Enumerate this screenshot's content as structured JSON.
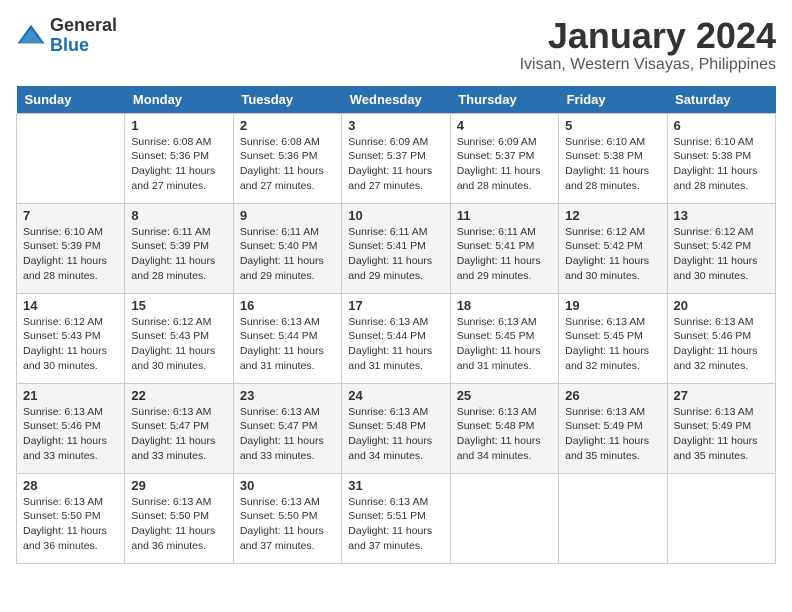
{
  "logo": {
    "general": "General",
    "blue": "Blue"
  },
  "title": {
    "month": "January 2024",
    "location": "Ivisan, Western Visayas, Philippines"
  },
  "weekdays": [
    "Sunday",
    "Monday",
    "Tuesday",
    "Wednesday",
    "Thursday",
    "Friday",
    "Saturday"
  ],
  "weeks": [
    [
      {
        "day": "",
        "sunrise": "",
        "sunset": "",
        "daylight": ""
      },
      {
        "day": "1",
        "sunrise": "Sunrise: 6:08 AM",
        "sunset": "Sunset: 5:36 PM",
        "daylight": "Daylight: 11 hours and 27 minutes."
      },
      {
        "day": "2",
        "sunrise": "Sunrise: 6:08 AM",
        "sunset": "Sunset: 5:36 PM",
        "daylight": "Daylight: 11 hours and 27 minutes."
      },
      {
        "day": "3",
        "sunrise": "Sunrise: 6:09 AM",
        "sunset": "Sunset: 5:37 PM",
        "daylight": "Daylight: 11 hours and 27 minutes."
      },
      {
        "day": "4",
        "sunrise": "Sunrise: 6:09 AM",
        "sunset": "Sunset: 5:37 PM",
        "daylight": "Daylight: 11 hours and 28 minutes."
      },
      {
        "day": "5",
        "sunrise": "Sunrise: 6:10 AM",
        "sunset": "Sunset: 5:38 PM",
        "daylight": "Daylight: 11 hours and 28 minutes."
      },
      {
        "day": "6",
        "sunrise": "Sunrise: 6:10 AM",
        "sunset": "Sunset: 5:38 PM",
        "daylight": "Daylight: 11 hours and 28 minutes."
      }
    ],
    [
      {
        "day": "7",
        "sunrise": "Sunrise: 6:10 AM",
        "sunset": "Sunset: 5:39 PM",
        "daylight": "Daylight: 11 hours and 28 minutes."
      },
      {
        "day": "8",
        "sunrise": "Sunrise: 6:11 AM",
        "sunset": "Sunset: 5:39 PM",
        "daylight": "Daylight: 11 hours and 28 minutes."
      },
      {
        "day": "9",
        "sunrise": "Sunrise: 6:11 AM",
        "sunset": "Sunset: 5:40 PM",
        "daylight": "Daylight: 11 hours and 29 minutes."
      },
      {
        "day": "10",
        "sunrise": "Sunrise: 6:11 AM",
        "sunset": "Sunset: 5:41 PM",
        "daylight": "Daylight: 11 hours and 29 minutes."
      },
      {
        "day": "11",
        "sunrise": "Sunrise: 6:11 AM",
        "sunset": "Sunset: 5:41 PM",
        "daylight": "Daylight: 11 hours and 29 minutes."
      },
      {
        "day": "12",
        "sunrise": "Sunrise: 6:12 AM",
        "sunset": "Sunset: 5:42 PM",
        "daylight": "Daylight: 11 hours and 30 minutes."
      },
      {
        "day": "13",
        "sunrise": "Sunrise: 6:12 AM",
        "sunset": "Sunset: 5:42 PM",
        "daylight": "Daylight: 11 hours and 30 minutes."
      }
    ],
    [
      {
        "day": "14",
        "sunrise": "Sunrise: 6:12 AM",
        "sunset": "Sunset: 5:43 PM",
        "daylight": "Daylight: 11 hours and 30 minutes."
      },
      {
        "day": "15",
        "sunrise": "Sunrise: 6:12 AM",
        "sunset": "Sunset: 5:43 PM",
        "daylight": "Daylight: 11 hours and 30 minutes."
      },
      {
        "day": "16",
        "sunrise": "Sunrise: 6:13 AM",
        "sunset": "Sunset: 5:44 PM",
        "daylight": "Daylight: 11 hours and 31 minutes."
      },
      {
        "day": "17",
        "sunrise": "Sunrise: 6:13 AM",
        "sunset": "Sunset: 5:44 PM",
        "daylight": "Daylight: 11 hours and 31 minutes."
      },
      {
        "day": "18",
        "sunrise": "Sunrise: 6:13 AM",
        "sunset": "Sunset: 5:45 PM",
        "daylight": "Daylight: 11 hours and 31 minutes."
      },
      {
        "day": "19",
        "sunrise": "Sunrise: 6:13 AM",
        "sunset": "Sunset: 5:45 PM",
        "daylight": "Daylight: 11 hours and 32 minutes."
      },
      {
        "day": "20",
        "sunrise": "Sunrise: 6:13 AM",
        "sunset": "Sunset: 5:46 PM",
        "daylight": "Daylight: 11 hours and 32 minutes."
      }
    ],
    [
      {
        "day": "21",
        "sunrise": "Sunrise: 6:13 AM",
        "sunset": "Sunset: 5:46 PM",
        "daylight": "Daylight: 11 hours and 33 minutes."
      },
      {
        "day": "22",
        "sunrise": "Sunrise: 6:13 AM",
        "sunset": "Sunset: 5:47 PM",
        "daylight": "Daylight: 11 hours and 33 minutes."
      },
      {
        "day": "23",
        "sunrise": "Sunrise: 6:13 AM",
        "sunset": "Sunset: 5:47 PM",
        "daylight": "Daylight: 11 hours and 33 minutes."
      },
      {
        "day": "24",
        "sunrise": "Sunrise: 6:13 AM",
        "sunset": "Sunset: 5:48 PM",
        "daylight": "Daylight: 11 hours and 34 minutes."
      },
      {
        "day": "25",
        "sunrise": "Sunrise: 6:13 AM",
        "sunset": "Sunset: 5:48 PM",
        "daylight": "Daylight: 11 hours and 34 minutes."
      },
      {
        "day": "26",
        "sunrise": "Sunrise: 6:13 AM",
        "sunset": "Sunset: 5:49 PM",
        "daylight": "Daylight: 11 hours and 35 minutes."
      },
      {
        "day": "27",
        "sunrise": "Sunrise: 6:13 AM",
        "sunset": "Sunset: 5:49 PM",
        "daylight": "Daylight: 11 hours and 35 minutes."
      }
    ],
    [
      {
        "day": "28",
        "sunrise": "Sunrise: 6:13 AM",
        "sunset": "Sunset: 5:50 PM",
        "daylight": "Daylight: 11 hours and 36 minutes."
      },
      {
        "day": "29",
        "sunrise": "Sunrise: 6:13 AM",
        "sunset": "Sunset: 5:50 PM",
        "daylight": "Daylight: 11 hours and 36 minutes."
      },
      {
        "day": "30",
        "sunrise": "Sunrise: 6:13 AM",
        "sunset": "Sunset: 5:50 PM",
        "daylight": "Daylight: 11 hours and 37 minutes."
      },
      {
        "day": "31",
        "sunrise": "Sunrise: 6:13 AM",
        "sunset": "Sunset: 5:51 PM",
        "daylight": "Daylight: 11 hours and 37 minutes."
      },
      {
        "day": "",
        "sunrise": "",
        "sunset": "",
        "daylight": ""
      },
      {
        "day": "",
        "sunrise": "",
        "sunset": "",
        "daylight": ""
      },
      {
        "day": "",
        "sunrise": "",
        "sunset": "",
        "daylight": ""
      }
    ]
  ]
}
